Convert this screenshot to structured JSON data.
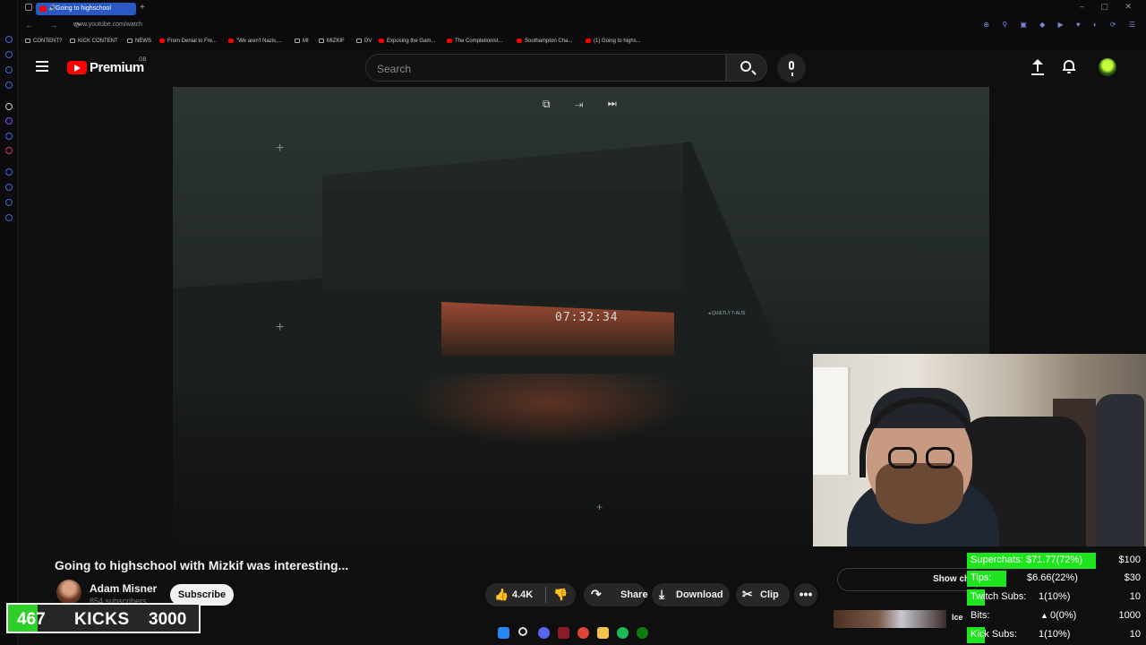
{
  "browser": {
    "tab_title": "Going to highschool",
    "tab_speaker": "🔊",
    "new_tab": "+",
    "window_controls": "– ▢ ✕",
    "nav": "← → ⟳",
    "url": "www.youtube.com/watch",
    "bookmarks": [
      {
        "label": "CONTENT?",
        "icon": "folder-icon"
      },
      {
        "label": "KICK CONTENT",
        "icon": "folder-icon"
      },
      {
        "label": "NEWS",
        "icon": "folder-icon"
      },
      {
        "label": "From Denial to Fre...",
        "icon": "youtube-icon"
      },
      {
        "label": "\"We aren't Nazis,...",
        "icon": "youtube-icon"
      },
      {
        "label": "MI",
        "icon": "folder-icon"
      },
      {
        "label": "MIZKIF",
        "icon": "folder-icon"
      },
      {
        "label": "DV",
        "icon": "folder-icon"
      },
      {
        "label": "Exposing the Gam...",
        "icon": "youtube-icon"
      },
      {
        "label": "The Completionist...",
        "icon": "youtube-icon"
      },
      {
        "label": "Southampton Cha...",
        "icon": "youtube-icon"
      },
      {
        "label": "(1) Going to highs...",
        "icon": "youtube-icon"
      }
    ],
    "extension_icons": "⊕ ⚲ ▣ ◆ ▶ ♥ ◐ ⟳ ☰"
  },
  "youtube": {
    "logo_text": "Premium",
    "logo_region": "GB",
    "search_placeholder": "Search",
    "accent": "#ff0000"
  },
  "video": {
    "player_controls": "⧉ ⇥ ⏭",
    "overlay_clock": "07:32:34",
    "overlay_tag": "◂ QUIETLY T-ALIS",
    "title": "Going to highschool with Mizkif was interesting...",
    "channel_name": "Adam Misner",
    "channel_subs": "854 subscribers",
    "subscribe_label": "Subscribe",
    "like_count": "4.4K",
    "like_icon": "👍",
    "dislike_icon": "👎",
    "share_label": "Share",
    "share_icon": "↷",
    "download_label": "Download",
    "download_icon": "⤓",
    "clip_label": "Clip",
    "clip_icon": "✂",
    "more_label": "•••",
    "show_chat": "Show chat replay",
    "recommended_title": "Ice"
  },
  "donations": [
    {
      "label": "Superchats:",
      "value": "$71.77(72%)",
      "goal": "$100",
      "fraction": 0.72
    },
    {
      "label": "Tips:",
      "value": "$6.66(22%)",
      "goal": "$30",
      "fraction": 0.22
    },
    {
      "label": "Twitch Subs:",
      "value": "1(10%)",
      "goal": "10",
      "fraction": 0.1
    },
    {
      "label": "Bits:",
      "value": "0(0%)",
      "goal": "1000",
      "fraction": 0.0
    },
    {
      "label": "Kick Subs:",
      "value": "1(10%)",
      "goal": "10",
      "fraction": 0.1
    }
  ],
  "donation_color": "#1fe51f",
  "kicks": {
    "count": "467",
    "label": "KICKS",
    "goal": "3000",
    "fraction": 0.1557,
    "color": "#2ecf28"
  }
}
